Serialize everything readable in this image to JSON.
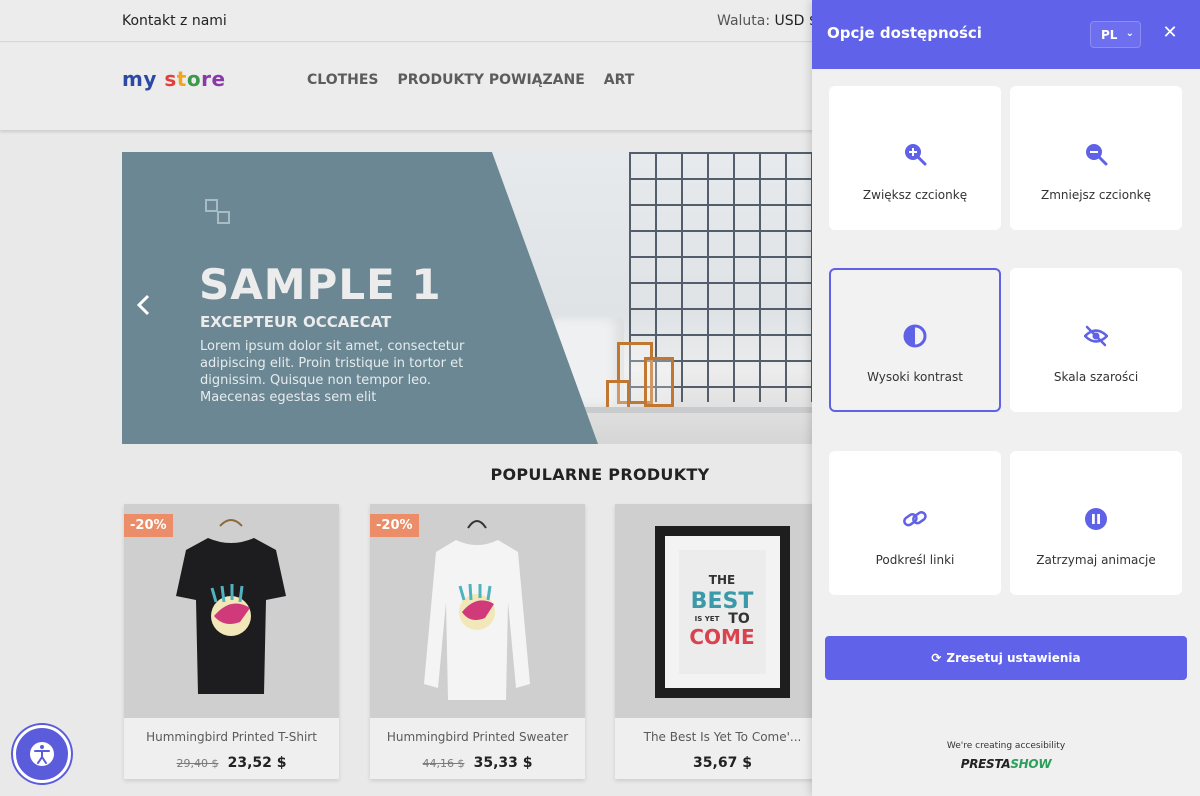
{
  "topbar": {
    "contact": "Kontakt z nami",
    "currency_label": "Waluta:",
    "currency_value": "USD $"
  },
  "header": {
    "logo": {
      "part1": "my",
      "part2": "s",
      "part3": "t",
      "part4": "o",
      "part5": "re"
    },
    "nav": [
      "CLOTHES",
      "PRODUKTY POWIĄZANE",
      "ART"
    ]
  },
  "hero": {
    "title": "SAMPLE 1",
    "subtitle": "EXCEPTEUR OCCAECAT",
    "body": "Lorem ipsum dolor sit amet, consectetur adipiscing elit. Proin tristique in tortor et dignissim. Quisque non tempor leo. Maecenas egestas sem elit"
  },
  "section_title": "POPULARNE PRODUKTY",
  "products": [
    {
      "name": "Hummingbird Printed T-Shirt",
      "badge": "-20%",
      "old_price": "29,40 $",
      "price": "23,52 $"
    },
    {
      "name": "Hummingbird Printed Sweater",
      "badge": "-20%",
      "old_price": "44,16 $",
      "price": "35,33 $"
    },
    {
      "name": "The Best Is Yet To Come'...",
      "price": "35,67 $",
      "poster": {
        "line1": "THE",
        "line2": "BEST",
        "line3": "IS YET",
        "line4": "TO",
        "line5": "COME"
      }
    }
  ],
  "accessibility": {
    "title": "Opcje dostępności",
    "language": "PL",
    "close_icon": "close-icon",
    "tiles": [
      {
        "label": "Zwiększ czcionkę",
        "icon": "zoom-in-icon"
      },
      {
        "label": "Zmniejsz czcionkę",
        "icon": "zoom-out-icon"
      },
      {
        "label": "Wysoki kontrast",
        "icon": "contrast-icon"
      },
      {
        "label": "Skala szarości",
        "icon": "eye-slash-icon"
      },
      {
        "label": "Podkreśl linki",
        "icon": "link-icon"
      },
      {
        "label": "Zatrzymaj animacje",
        "icon": "pause-icon"
      }
    ],
    "reset_label": "Zresetuj ustawienia",
    "footer_note": "We're creating accesibility",
    "brand_part1": "PRESTA",
    "brand_part2": "SHOW",
    "accent_color": "#6062ea"
  }
}
